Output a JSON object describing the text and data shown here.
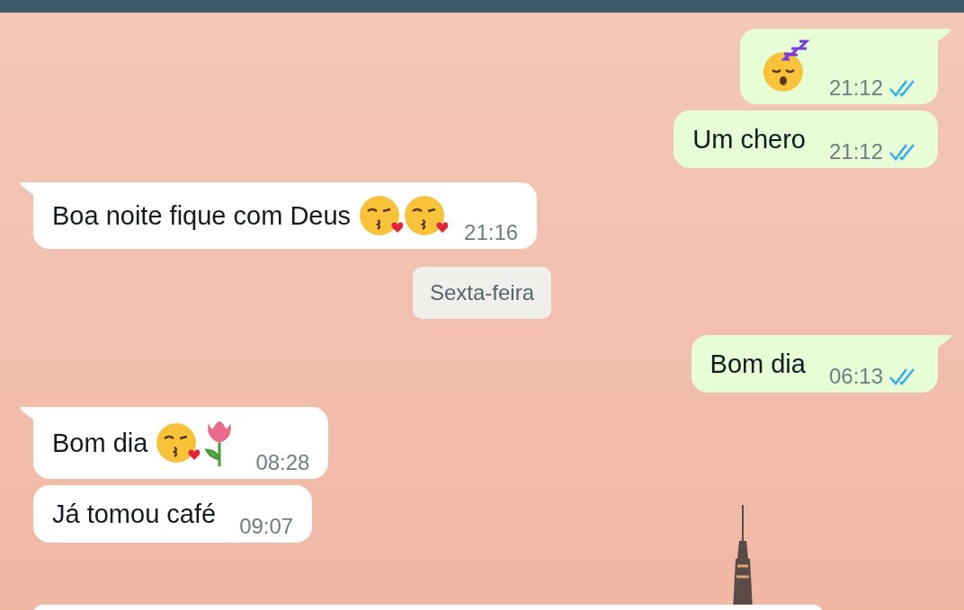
{
  "messages": [
    {
      "kind": "sent",
      "tail": true,
      "emoji": [
        {
          "kind": "sleeping"
        }
      ],
      "time": "21:12",
      "read": true
    },
    {
      "kind": "sent",
      "tail": false,
      "text": "Um chero",
      "time": "21:12",
      "read": true
    },
    {
      "kind": "received",
      "tail": true,
      "text": "Boa noite fique com Deus",
      "emoji": [
        {
          "kind": "kiss"
        },
        {
          "kind": "kiss"
        }
      ],
      "time": "21:16"
    },
    {
      "kind": "date",
      "text": "Sexta-feira"
    },
    {
      "kind": "sent",
      "tail": true,
      "text": "Bom dia",
      "time": "06:13",
      "read": true
    },
    {
      "kind": "received",
      "tail": true,
      "text": "Bom dia",
      "emoji": [
        {
          "kind": "kiss"
        },
        {
          "kind": "tulip"
        }
      ],
      "time": "08:28"
    },
    {
      "kind": "received",
      "tail": false,
      "text": "Já tomou café",
      "time": "09:07"
    }
  ]
}
